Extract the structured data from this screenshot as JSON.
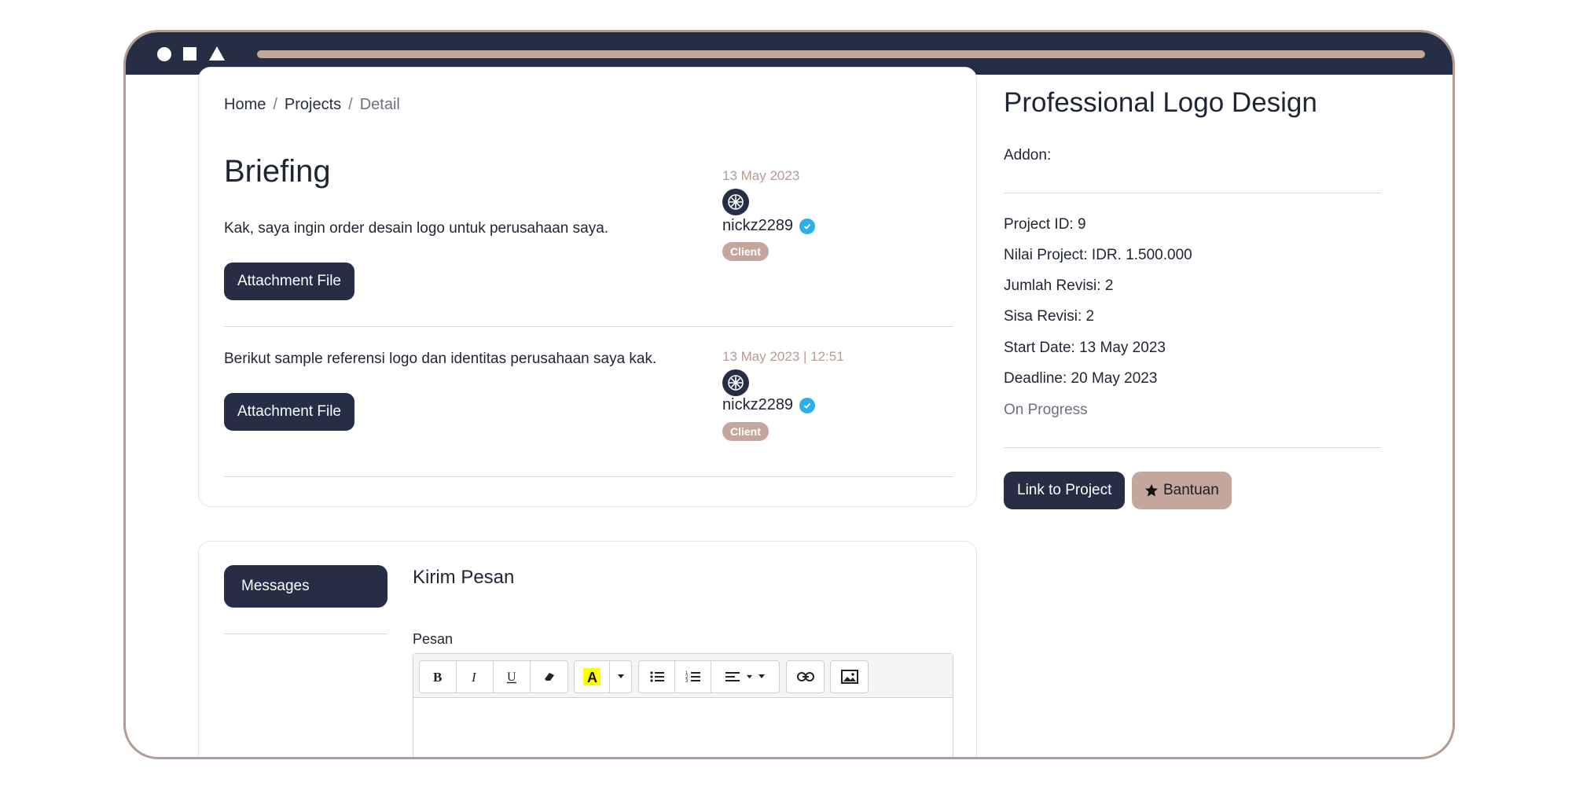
{
  "breadcrumb": {
    "home": "Home",
    "projects": "Projects",
    "current": "Detail",
    "separator": "/"
  },
  "briefing": {
    "heading": "Briefing",
    "entries": [
      {
        "date": "13 May 2023",
        "text": "Kak, saya ingin order desain logo untuk perusahaan saya.",
        "username": "nickz2289",
        "badge": "Client",
        "button": "Attachment File"
      },
      {
        "date": "13 May 2023 | 12:51",
        "text": "Berikut sample referensi logo dan identitas perusahaan saya kak.",
        "username": "nickz2289",
        "badge": "Client",
        "button": "Attachment File"
      }
    ]
  },
  "messages": {
    "tab_label": "Messages",
    "form_title": "Kirim Pesan",
    "field_label": "Pesan"
  },
  "project": {
    "title": "Professional Logo Design",
    "addon": "Addon:",
    "project_id": "Project ID: 9",
    "nilai": "Nilai Project: IDR. 1.500.000",
    "jumlah_revisi": "Jumlah Revisi: 2",
    "sisa_revisi": "Sisa Revisi: 2",
    "start_date": "Start Date: 13 May 2023",
    "deadline": "Deadline: 20 May 2023",
    "status": "On Progress",
    "link_button": "Link to Project",
    "help_button": "Bantuan"
  },
  "colors": {
    "navy": "#252e45",
    "rose": "#c5a69c",
    "verified_blue": "#2ab0ea",
    "highlight_yellow": "#ffff00"
  },
  "icons": [
    "avatar-logo-icon",
    "verified-check-icon",
    "star-icon",
    "bold-icon",
    "italic-icon",
    "underline-icon",
    "eraser-icon",
    "highlight-icon",
    "bullet-list-icon",
    "numbered-list-icon",
    "align-icon",
    "link-icon",
    "image-icon"
  ]
}
